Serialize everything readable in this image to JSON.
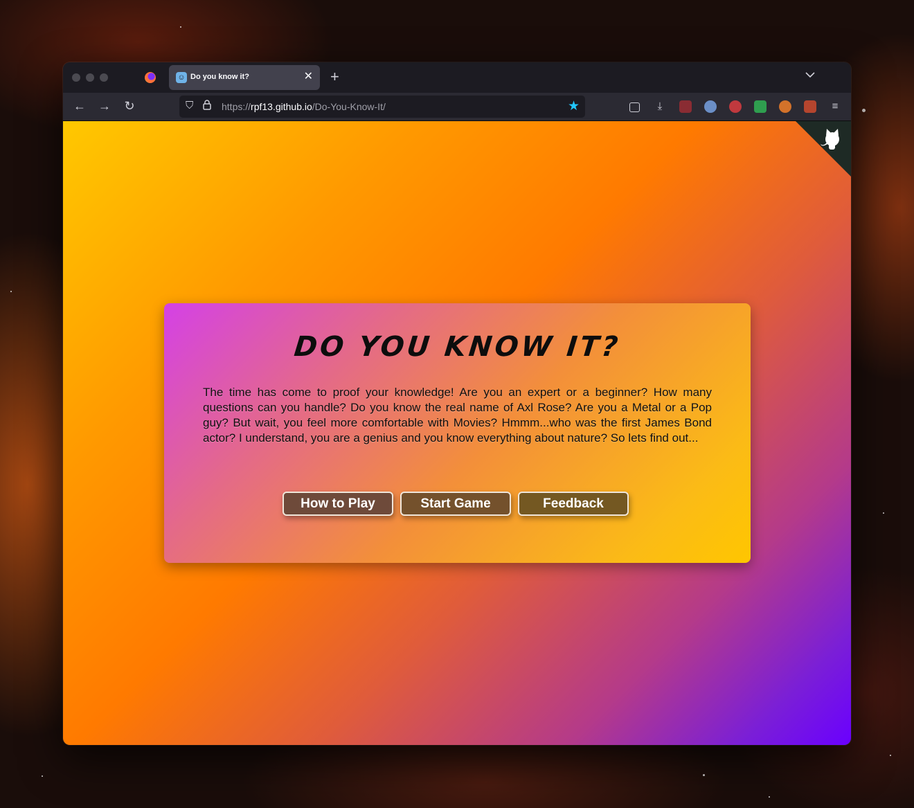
{
  "browser": {
    "tab": {
      "title": "Do you know it?",
      "favicon": "robot-icon"
    },
    "url": {
      "scheme": "https://",
      "host": "rpf13.github.io",
      "path": "/Do-You-Know-It/"
    },
    "extensions": [
      "pocket-icon",
      "downloads-icon",
      "ext-1-icon",
      "ext-2-icon",
      "ext-3-icon",
      "adblock-shield-icon",
      "ext-4-icon",
      "ext-5-icon",
      "menu-icon"
    ]
  },
  "page": {
    "title": "Do you know it?",
    "intro": "The time has come to proof your knowledge! Are you an expert or a beginner? How many questions can you handle? Do you know the real name of Axl Rose? Are you a Metal or a Pop guy? But wait, you feel more comfortable with Movies? Hmmm...who was the first James Bond actor? I understand, you are a genius and you know everything about nature? So lets find out...",
    "buttons": {
      "how_to_play": "How to Play",
      "start_game": "Start Game",
      "feedback": "Feedback"
    },
    "github_corner": "github-octocat-icon"
  },
  "colors": {
    "button_bg_1": "#6e4a3a",
    "button_bg_2": "#74512c",
    "button_bg_3": "#745822",
    "accent_star": "#22c7ff"
  }
}
